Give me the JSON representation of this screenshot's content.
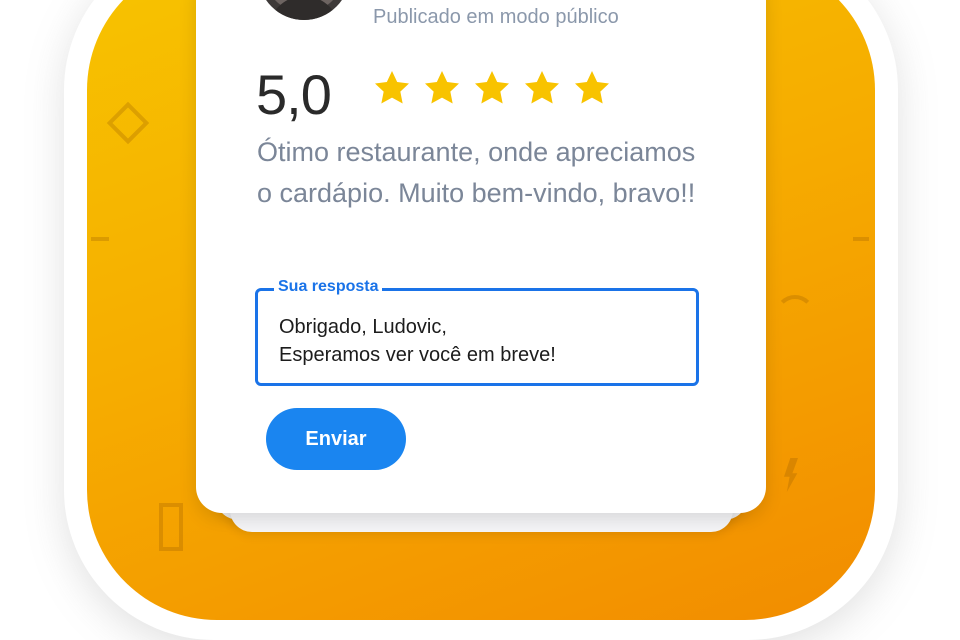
{
  "review_card": {
    "publish_status": "Publicado em modo público",
    "rating_value": "5,0",
    "stars": 5,
    "star_color": "#f8c300",
    "review_text": "Ótimo restaurante, onde apreciamos o cardápio. Muito bem-vindo, bravo!!"
  },
  "reply": {
    "label": "Sua resposta",
    "line1": "Obrigado, Ludovic,",
    "line2": "Esperamos ver você em breve!",
    "accent": "#1a73e8"
  },
  "actions": {
    "send_label": "Enviar",
    "send_color": "#1a85f0"
  },
  "background": {
    "gradient_from": "#f7c400",
    "gradient_to": "#f28c00"
  }
}
